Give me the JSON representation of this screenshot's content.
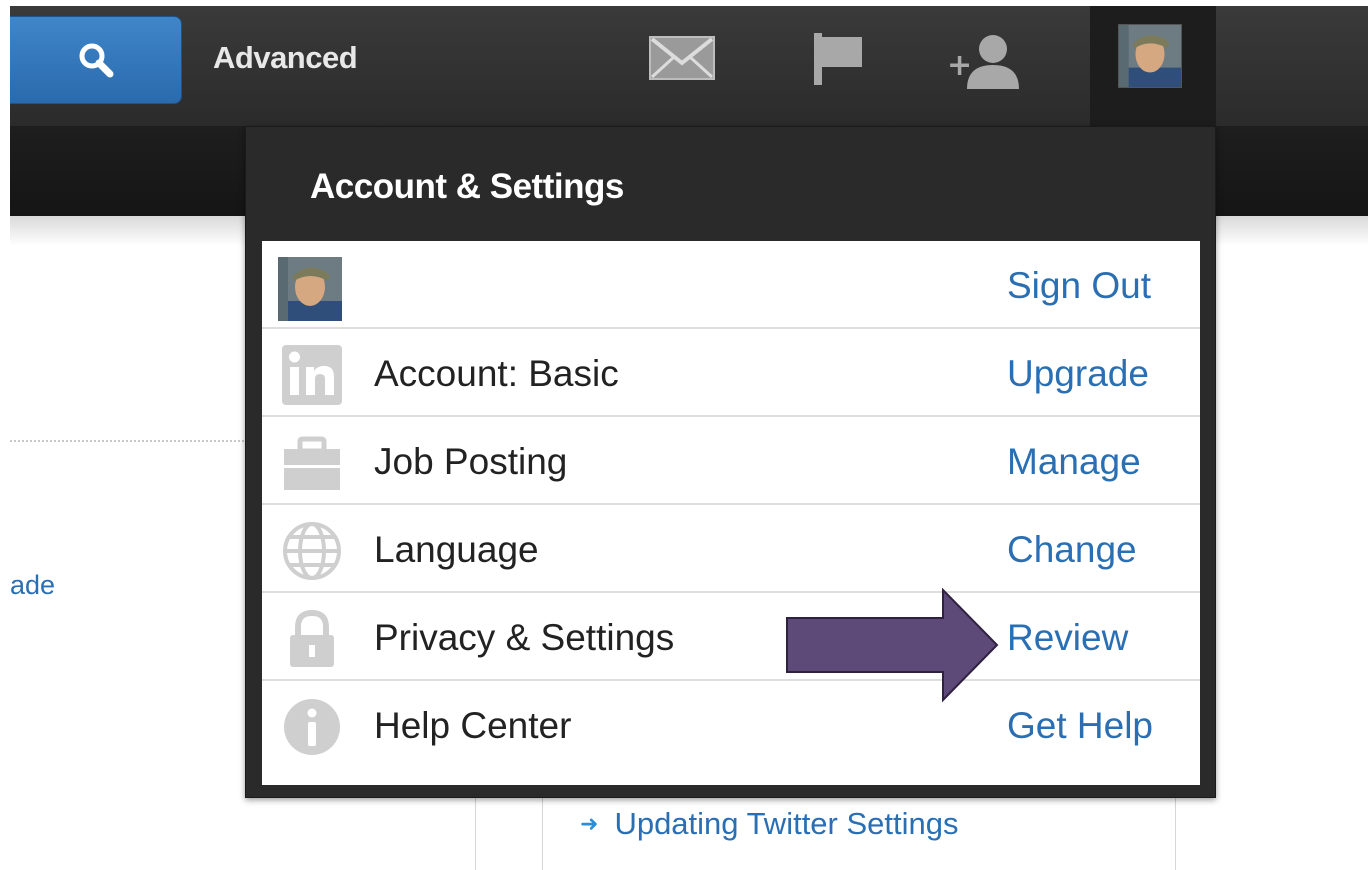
{
  "topbar": {
    "advanced_label": "Advanced"
  },
  "left": {
    "partial_link": "ade"
  },
  "dropdown": {
    "title": "Account & Settings",
    "rows": [
      {
        "label": "",
        "action": "Sign Out",
        "icon": "avatar"
      },
      {
        "label": "Account: Basic",
        "action": "Upgrade",
        "icon": "linkedin-icon"
      },
      {
        "label": "Job Posting",
        "action": "Manage",
        "icon": "briefcase-icon"
      },
      {
        "label": "Language",
        "action": "Change",
        "icon": "globe-icon"
      },
      {
        "label": "Privacy & Settings",
        "action": "Review",
        "icon": "lock-icon"
      },
      {
        "label": "Help Center",
        "action": "Get Help",
        "icon": "info-icon"
      }
    ]
  },
  "below": {
    "link_text": "Updating Twitter Settings"
  },
  "colors": {
    "link_blue": "#2a6fb3",
    "search_blue": "#2f75bd",
    "callout_purple": "#5e4a78",
    "topbar_dark": "#333333",
    "icon_gray": "#c8c8c8"
  }
}
